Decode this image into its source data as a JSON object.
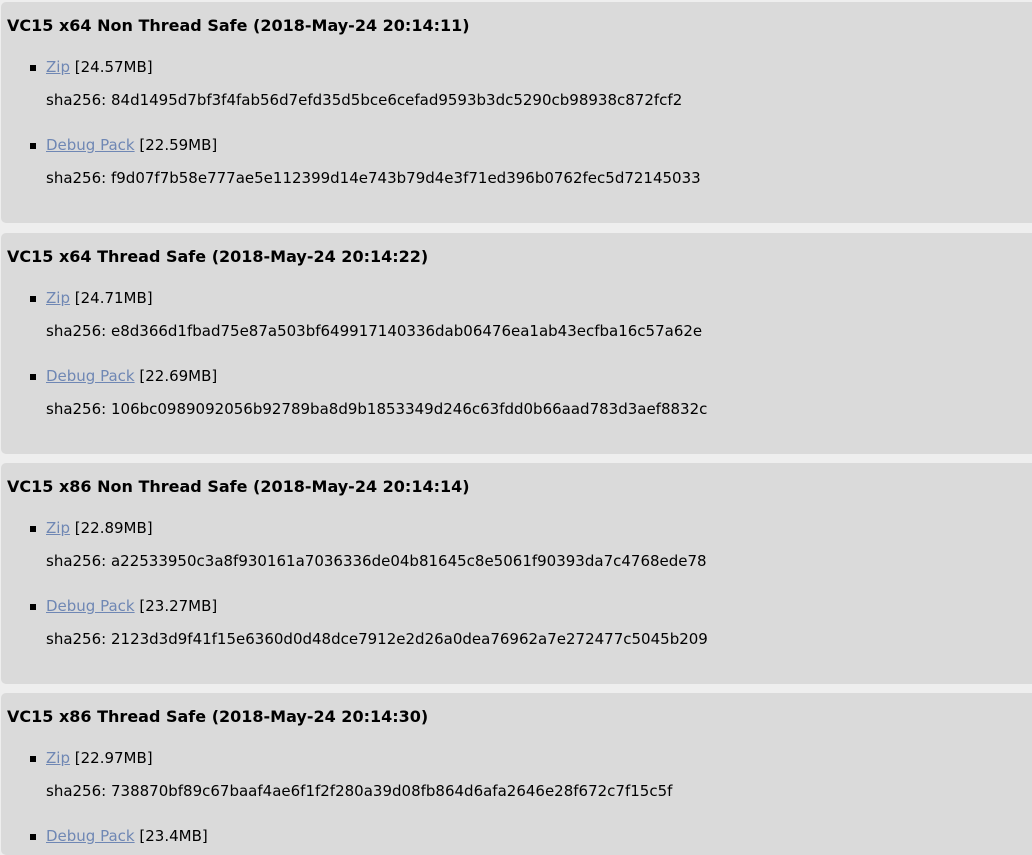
{
  "builds": [
    {
      "title": "VC15 x64 Non Thread Safe (2018-May-24 20:14:11)",
      "downloads": [
        {
          "link_label": "Zip",
          "size": "[24.57MB]",
          "sha_label": "sha256:",
          "sha": "84d1495d7bf3f4fab56d7efd35d5bce6cefad9593b3dc5290cb98938c872fcf2"
        },
        {
          "link_label": "Debug Pack",
          "size": "[22.59MB]",
          "sha_label": "sha256:",
          "sha": "f9d07f7b58e777ae5e112399d14e743b79d4e3f71ed396b0762fec5d72145033"
        }
      ]
    },
    {
      "title": "VC15 x64 Thread Safe (2018-May-24 20:14:22)",
      "downloads": [
        {
          "link_label": "Zip",
          "size": "[24.71MB]",
          "sha_label": "sha256:",
          "sha": "e8d366d1fbad75e87a503bf649917140336dab06476ea1ab43ecfba16c57a62e"
        },
        {
          "link_label": "Debug Pack",
          "size": "[22.69MB]",
          "sha_label": "sha256:",
          "sha": "106bc0989092056b92789ba8d9b1853349d246c63fdd0b66aad783d3aef8832c"
        }
      ]
    },
    {
      "title": "VC15 x86 Non Thread Safe (2018-May-24 20:14:14)",
      "downloads": [
        {
          "link_label": "Zip",
          "size": "[22.89MB]",
          "sha_label": "sha256:",
          "sha": "a22533950c3a8f930161a7036336de04b81645c8e5061f90393da7c4768ede78"
        },
        {
          "link_label": "Debug Pack",
          "size": "[23.27MB]",
          "sha_label": "sha256:",
          "sha": "2123d3d9f41f15e6360d0d48dce7912e2d26a0dea76962a7e272477c5045b209"
        }
      ]
    },
    {
      "title": "VC15 x86 Thread Safe (2018-May-24 20:14:30)",
      "downloads": [
        {
          "link_label": "Zip",
          "size": "[22.97MB]",
          "sha_label": "sha256:",
          "sha": "738870bf89c67baaf4ae6f1f2f280a39d08fb864d6afa2646e28f672c7f15c5f"
        },
        {
          "link_label": "Debug Pack",
          "size": "[23.4MB]"
        }
      ]
    }
  ]
}
